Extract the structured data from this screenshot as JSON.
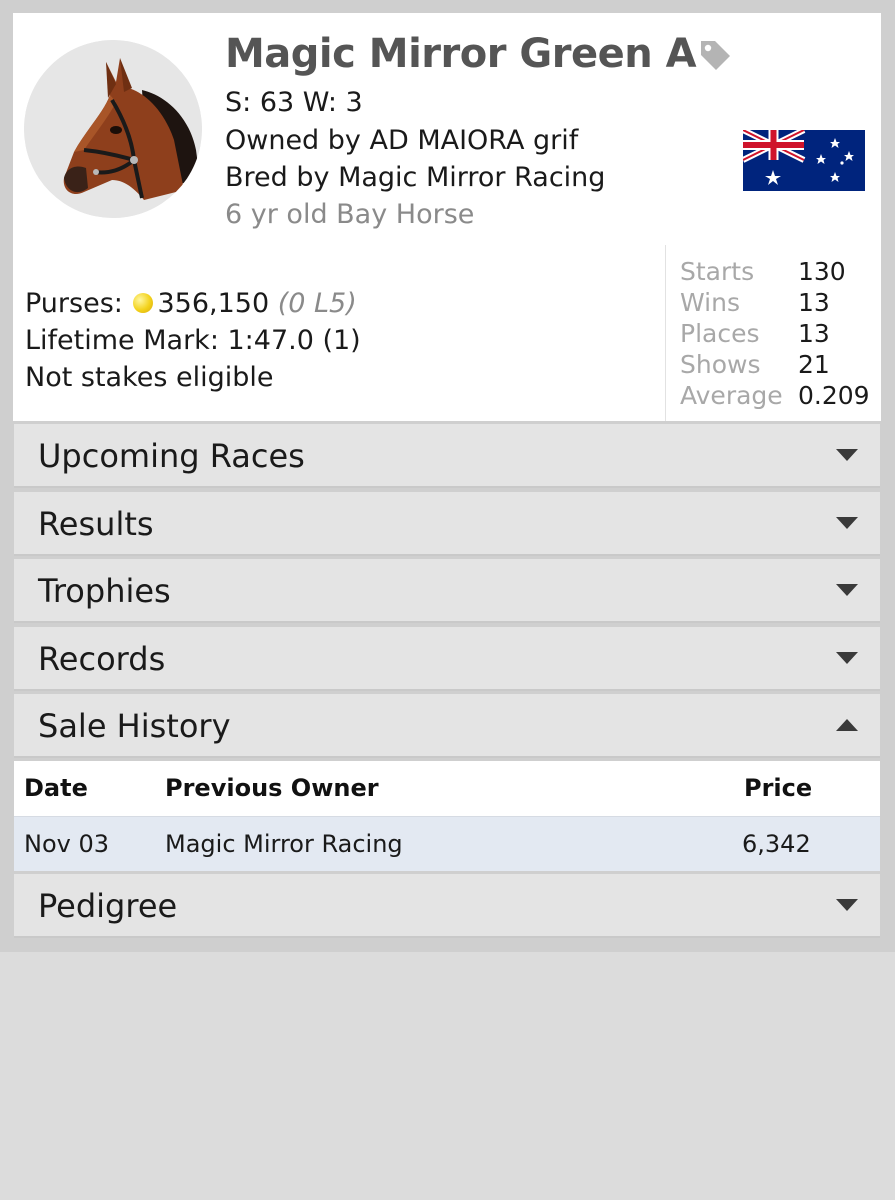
{
  "horse": {
    "name": "Magic Mirror Green A",
    "sw": "S: 63 W: 3",
    "owner": "Owned by AD MAIORA grif",
    "breeder": "Bred by Magic Mirror Racing",
    "description": "6 yr old Bay Horse",
    "country_flag": "australia-flag"
  },
  "earnings": {
    "purses_label": "Purses:",
    "purses_value": "356,150",
    "purses_l5": "(0 L5)",
    "lifetime_mark": "Lifetime Mark: 1:47.0 (1)",
    "stakes": "Not stakes eligible"
  },
  "stats": [
    {
      "label": "Starts",
      "value": "130"
    },
    {
      "label": "Wins",
      "value": "13"
    },
    {
      "label": "Places",
      "value": "13"
    },
    {
      "label": "Shows",
      "value": "21"
    },
    {
      "label": "Average",
      "value": "0.209"
    }
  ],
  "sections": {
    "upcoming": "Upcoming Races",
    "results": "Results",
    "trophies": "Trophies",
    "records": "Records",
    "sale_history": "Sale History",
    "pedigree": "Pedigree"
  },
  "sale_history": {
    "headers": {
      "date": "Date",
      "owner": "Previous Owner",
      "price": "Price"
    },
    "rows": [
      {
        "date": "Nov 03",
        "owner": "Magic Mirror Racing",
        "price": "6,342"
      }
    ]
  },
  "colors": {
    "name_gray": "#555555",
    "section_bg": "#e4e4e4",
    "highlight_row": "#e3e9f2",
    "coin_gold": "#f3d21b"
  },
  "icons": [
    "horse-avatar",
    "tag-icon",
    "australia-flag",
    "coin-icon",
    "chevron-down-icon",
    "chevron-up-icon"
  ]
}
